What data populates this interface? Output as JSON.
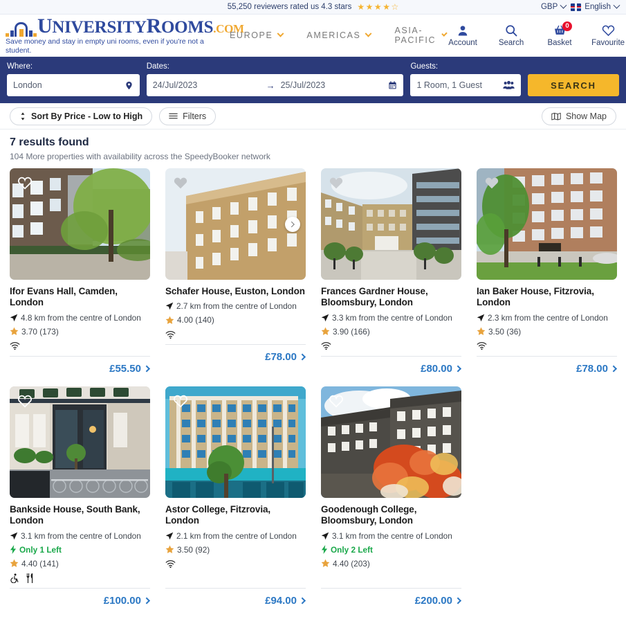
{
  "topbar": {
    "rating_text": "55,250 reviewers rated us 4.3 stars",
    "stars_full": 4,
    "stars_half": 1,
    "currency": "GBP",
    "language": "English",
    "star_color": "#f5b431"
  },
  "brand": {
    "name_part1": "U",
    "name_part2": "NIVERSITY",
    "name_part3": "R",
    "name_part4": "OOMS",
    "dotcom": ".COM",
    "tagline": "Save money and stay in empty uni rooms, even if you're not a student.",
    "blue": "#2f4a9e",
    "gold": "#f0a830"
  },
  "nav": {
    "items": [
      {
        "label": "EUROPE"
      },
      {
        "label": "AMERICAS"
      },
      {
        "label": "ASIA-PACIFIC"
      }
    ]
  },
  "header_icons": [
    {
      "label": "Account",
      "icon": "account-icon"
    },
    {
      "label": "Search",
      "icon": "search-icon"
    },
    {
      "label": "Basket",
      "icon": "basket-icon",
      "badge": "0"
    },
    {
      "label": "Favourite",
      "icon": "heart-icon"
    }
  ],
  "search": {
    "where_label": "Where:",
    "where_value": "London",
    "dates_label": "Dates:",
    "date_from": "24/Jul/2023",
    "date_to": "25/Jul/2023",
    "guests_label": "Guests:",
    "guests_value": "1 Room, 1 Guest",
    "search_button": "SEARCH",
    "band_color": "#2b3a7a",
    "button_color": "#f5b72b"
  },
  "filterbar": {
    "sort_label": "Sort By Price - Low to High",
    "filters_label": "Filters",
    "show_map_label": "Show Map"
  },
  "results": {
    "title": "7 results found",
    "subtitle": "104 More properties with availability across the SpeedyBooker network",
    "cards": [
      {
        "title": "Ifor Evans Hall, Camden, London",
        "distance": "4.8 km from the centre of London",
        "rating": "3.70 (173)",
        "availability": "",
        "amenities": [
          "wifi-icon"
        ],
        "price": "£55.50",
        "has_carousel_arrow": false,
        "heart_state": "outline-white"
      },
      {
        "title": "Schafer House, Euston, London",
        "distance": "2.7 km from the centre of London",
        "rating": "4.00 (140)",
        "availability": "",
        "amenities": [
          "wifi-icon"
        ],
        "price": "£78.00",
        "has_carousel_arrow": true,
        "heart_state": "solid-grey"
      },
      {
        "title": "Frances Gardner House, Bloomsbury, London",
        "distance": "3.3 km from the centre of London",
        "rating": "3.90 (166)",
        "availability": "",
        "amenities": [
          "wifi-icon"
        ],
        "price": "£80.00",
        "has_carousel_arrow": false,
        "heart_state": "solid-grey"
      },
      {
        "title": "Ian Baker House, Fitzrovia, London",
        "distance": "2.3 km from the centre of London",
        "rating": "3.50 (36)",
        "availability": "",
        "amenities": [
          "wifi-icon"
        ],
        "price": "£78.00",
        "has_carousel_arrow": false,
        "heart_state": "solid-grey"
      },
      {
        "title": "Bankside House, South Bank, London",
        "distance": "3.1 km from the centre of London",
        "rating": "4.40 (141)",
        "availability": "Only 1 Left",
        "amenities": [
          "wheelchair-icon",
          "restaurant-icon"
        ],
        "price": "£100.00",
        "has_carousel_arrow": false,
        "heart_state": "outline-white"
      },
      {
        "title": "Astor College, Fitzrovia, London",
        "distance": "2.1 km from the centre of London",
        "rating": "3.50 (92)",
        "availability": "",
        "amenities": [
          "wifi-icon"
        ],
        "price": "£94.00",
        "has_carousel_arrow": false,
        "heart_state": "outline-white"
      },
      {
        "title": "Goodenough College, Bloomsbury, London",
        "distance": "3.1 km from the centre of London",
        "rating": "4.40 (203)",
        "availability": "Only 2 Left",
        "amenities": [],
        "price": "£200.00",
        "has_carousel_arrow": false,
        "heart_state": "outline-white"
      }
    ],
    "colors": {
      "price": "#2c78c4",
      "availability": "#1aa84a",
      "rating_star": "#e8a33d"
    }
  }
}
